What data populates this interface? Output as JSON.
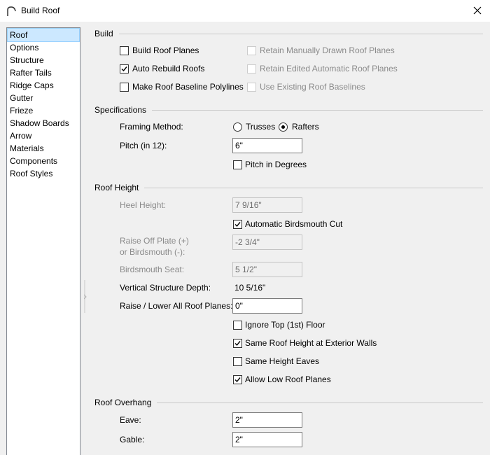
{
  "window": {
    "title": "Build Roof",
    "icon": "roof-icon",
    "close_icon": "close-icon"
  },
  "sidebar": {
    "items": [
      {
        "label": "Roof",
        "selected": true
      },
      {
        "label": "Options"
      },
      {
        "label": "Structure"
      },
      {
        "label": "Rafter Tails"
      },
      {
        "label": "Ridge Caps"
      },
      {
        "label": "Gutter"
      },
      {
        "label": "Frieze"
      },
      {
        "label": "Shadow Boards"
      },
      {
        "label": "Arrow"
      },
      {
        "label": "Materials"
      },
      {
        "label": "Components"
      },
      {
        "label": "Roof Styles"
      }
    ]
  },
  "build": {
    "title": "Build",
    "build_roof_planes": {
      "label": "Build Roof Planes",
      "checked": false
    },
    "auto_rebuild_roofs": {
      "label": "Auto Rebuild Roofs",
      "checked": true
    },
    "make_baseline_polylines": {
      "label": "Make Roof Baseline Polylines",
      "checked": false
    },
    "retain_manual": {
      "label": "Retain Manually Drawn Roof Planes",
      "checked": false,
      "disabled": true
    },
    "retain_edited": {
      "label": "Retain Edited Automatic Roof Planes",
      "checked": false,
      "disabled": true
    },
    "use_existing": {
      "label": "Use Existing Roof Baselines",
      "checked": false,
      "disabled": true
    }
  },
  "specifications": {
    "title": "Specifications",
    "framing_label": "Framing Method:",
    "trusses_label": "Trusses",
    "rafters_label": "Rafters",
    "framing_selected": "Rafters",
    "pitch_label": "Pitch (in 12):",
    "pitch_value": "6\"",
    "pitch_degrees": {
      "label": "Pitch in Degrees",
      "checked": false
    }
  },
  "roof_height": {
    "title": "Roof Height",
    "heel_label": "Heel Height:",
    "heel_value": "7 9/16\"",
    "birdsmouth_cut": {
      "label": "Automatic Birdsmouth Cut",
      "checked": true
    },
    "raise_plate_label_1": "Raise Off Plate (+)",
    "raise_plate_label_2": "or Birdsmouth (-):",
    "raise_plate_value": "-2 3/4\"",
    "seat_label": "Birdsmouth Seat:",
    "seat_value": "5 1/2\"",
    "vsd_label": "Vertical Structure Depth:",
    "vsd_value": "10 5/16\"",
    "raise_all_label": "Raise / Lower All Roof Planes:",
    "raise_all_value": "0\"",
    "ignore_top": {
      "label": "Ignore Top (1st) Floor",
      "checked": false
    },
    "same_height_exterior": {
      "label": "Same Roof Height at Exterior Walls",
      "checked": true
    },
    "same_height_eaves": {
      "label": "Same Height Eaves",
      "checked": false
    },
    "allow_low": {
      "label": "Allow Low Roof Planes",
      "checked": true
    }
  },
  "overhang": {
    "title": "Roof Overhang",
    "eave_label": "Eave:",
    "eave_value": "2\"",
    "gable_label": "Gable:",
    "gable_value": "2\""
  }
}
